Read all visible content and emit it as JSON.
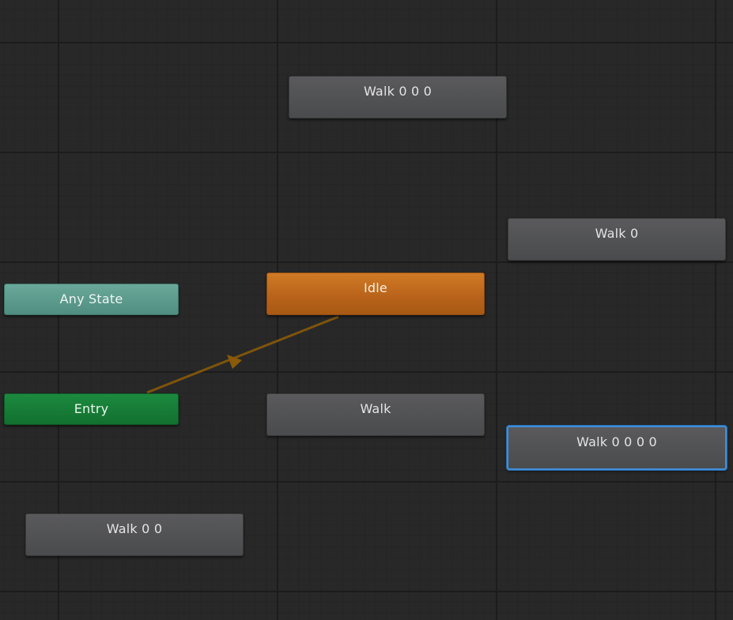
{
  "graph": {
    "nodes": {
      "walk000": {
        "label": "Walk 0 0 0",
        "type": "state"
      },
      "walk0": {
        "label": "Walk 0",
        "type": "state"
      },
      "anystate": {
        "label": "Any State",
        "type": "any-state"
      },
      "idle": {
        "label": "Idle",
        "type": "default-state"
      },
      "entry": {
        "label": "Entry",
        "type": "entry"
      },
      "walk": {
        "label": "Walk",
        "type": "state"
      },
      "walk0000": {
        "label": "Walk 0 0 0 0",
        "type": "state",
        "selected": true
      },
      "walk00": {
        "label": "Walk 0 0",
        "type": "state"
      }
    },
    "transitions": [
      {
        "from": "Entry",
        "to": "Idle",
        "color": "#8a5a0a"
      }
    ]
  },
  "colors": {
    "background": "#282828",
    "state": "#4f5052",
    "default_state": "#c56d1e",
    "any_state": "#5c9b8d",
    "entry": "#16803a",
    "selection": "#3f8fd8",
    "transition": "#8a5a0a"
  }
}
